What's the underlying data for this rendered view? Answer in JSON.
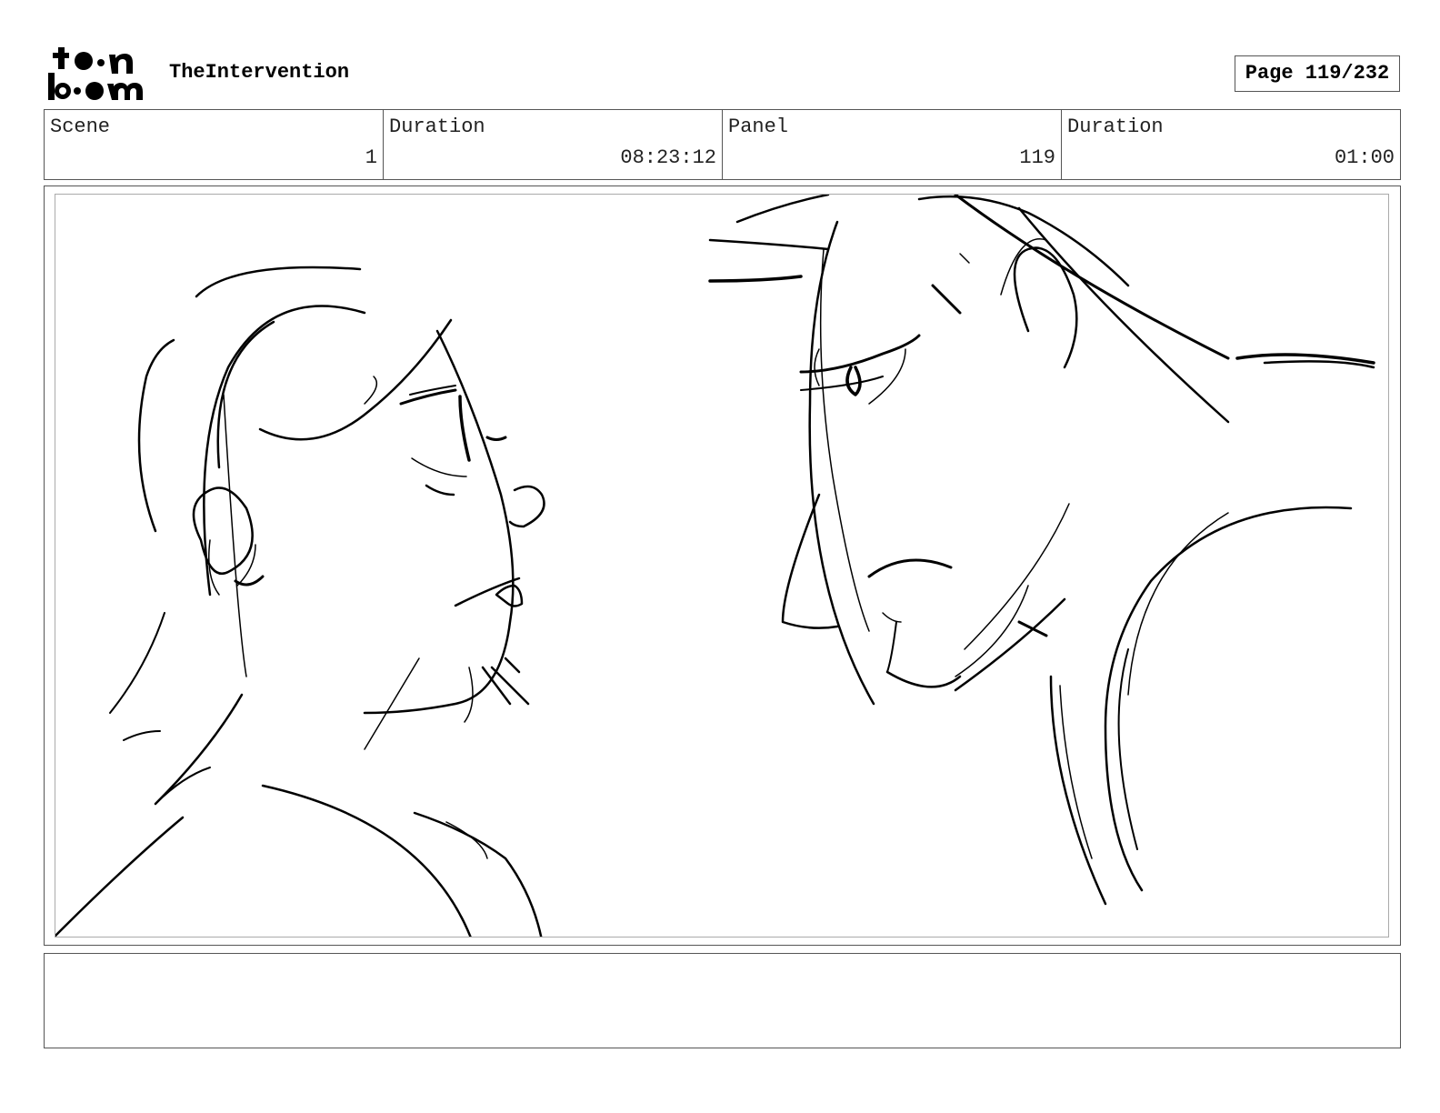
{
  "header": {
    "logo_icon": "toonboom-logo",
    "logo_line1": "t●●n",
    "logo_line2": "b●●m",
    "project_title": "TheIntervention",
    "page_label": "Page 119/232"
  },
  "info": {
    "scene_label": "Scene",
    "scene_value": "1",
    "scene_duration_label": "Duration",
    "scene_duration_value": "08:23:12",
    "panel_label": "Panel",
    "panel_value": "119",
    "panel_duration_label": "Duration",
    "panel_duration_value": "01:00"
  },
  "panel": {
    "image_icon": "storyboard-sketch-two-characters-facing"
  },
  "notes": {
    "text": ""
  }
}
